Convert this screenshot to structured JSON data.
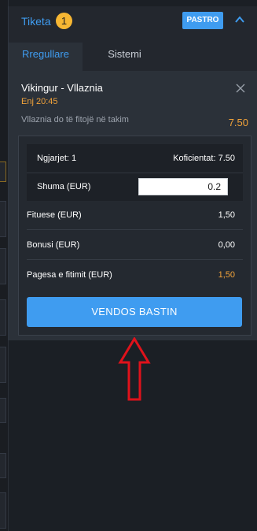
{
  "header": {
    "title": "Tiketa",
    "count": "1",
    "clear_label": "PASTRO"
  },
  "tabs": [
    {
      "label": "Rregullare"
    },
    {
      "label": "Sistemi"
    }
  ],
  "bet": {
    "match": "Vikingur - Vllaznia",
    "time": "Enj 20:45",
    "selection": "Vllaznia do të fitojë në takim",
    "odds": "7.50"
  },
  "slip": {
    "events_label": "Ngjarjet: 1",
    "coef_label": "Koficientat: 7.50",
    "stake_label": "Shuma (EUR)",
    "stake_value": "0.2",
    "win_label": "Fituese (EUR)",
    "win_value": "1,50",
    "bonus_label": "Bonusi (EUR)",
    "bonus_value": "0,00",
    "payout_label": "Pagesa e fitimit (EUR)",
    "payout_value": "1,50",
    "submit_label": "VENDOS BASTIN"
  },
  "colors": {
    "accent": "#3f9cf0",
    "orange": "#f2a33a",
    "badge": "#f7b733",
    "arrow": "#e0121b"
  }
}
